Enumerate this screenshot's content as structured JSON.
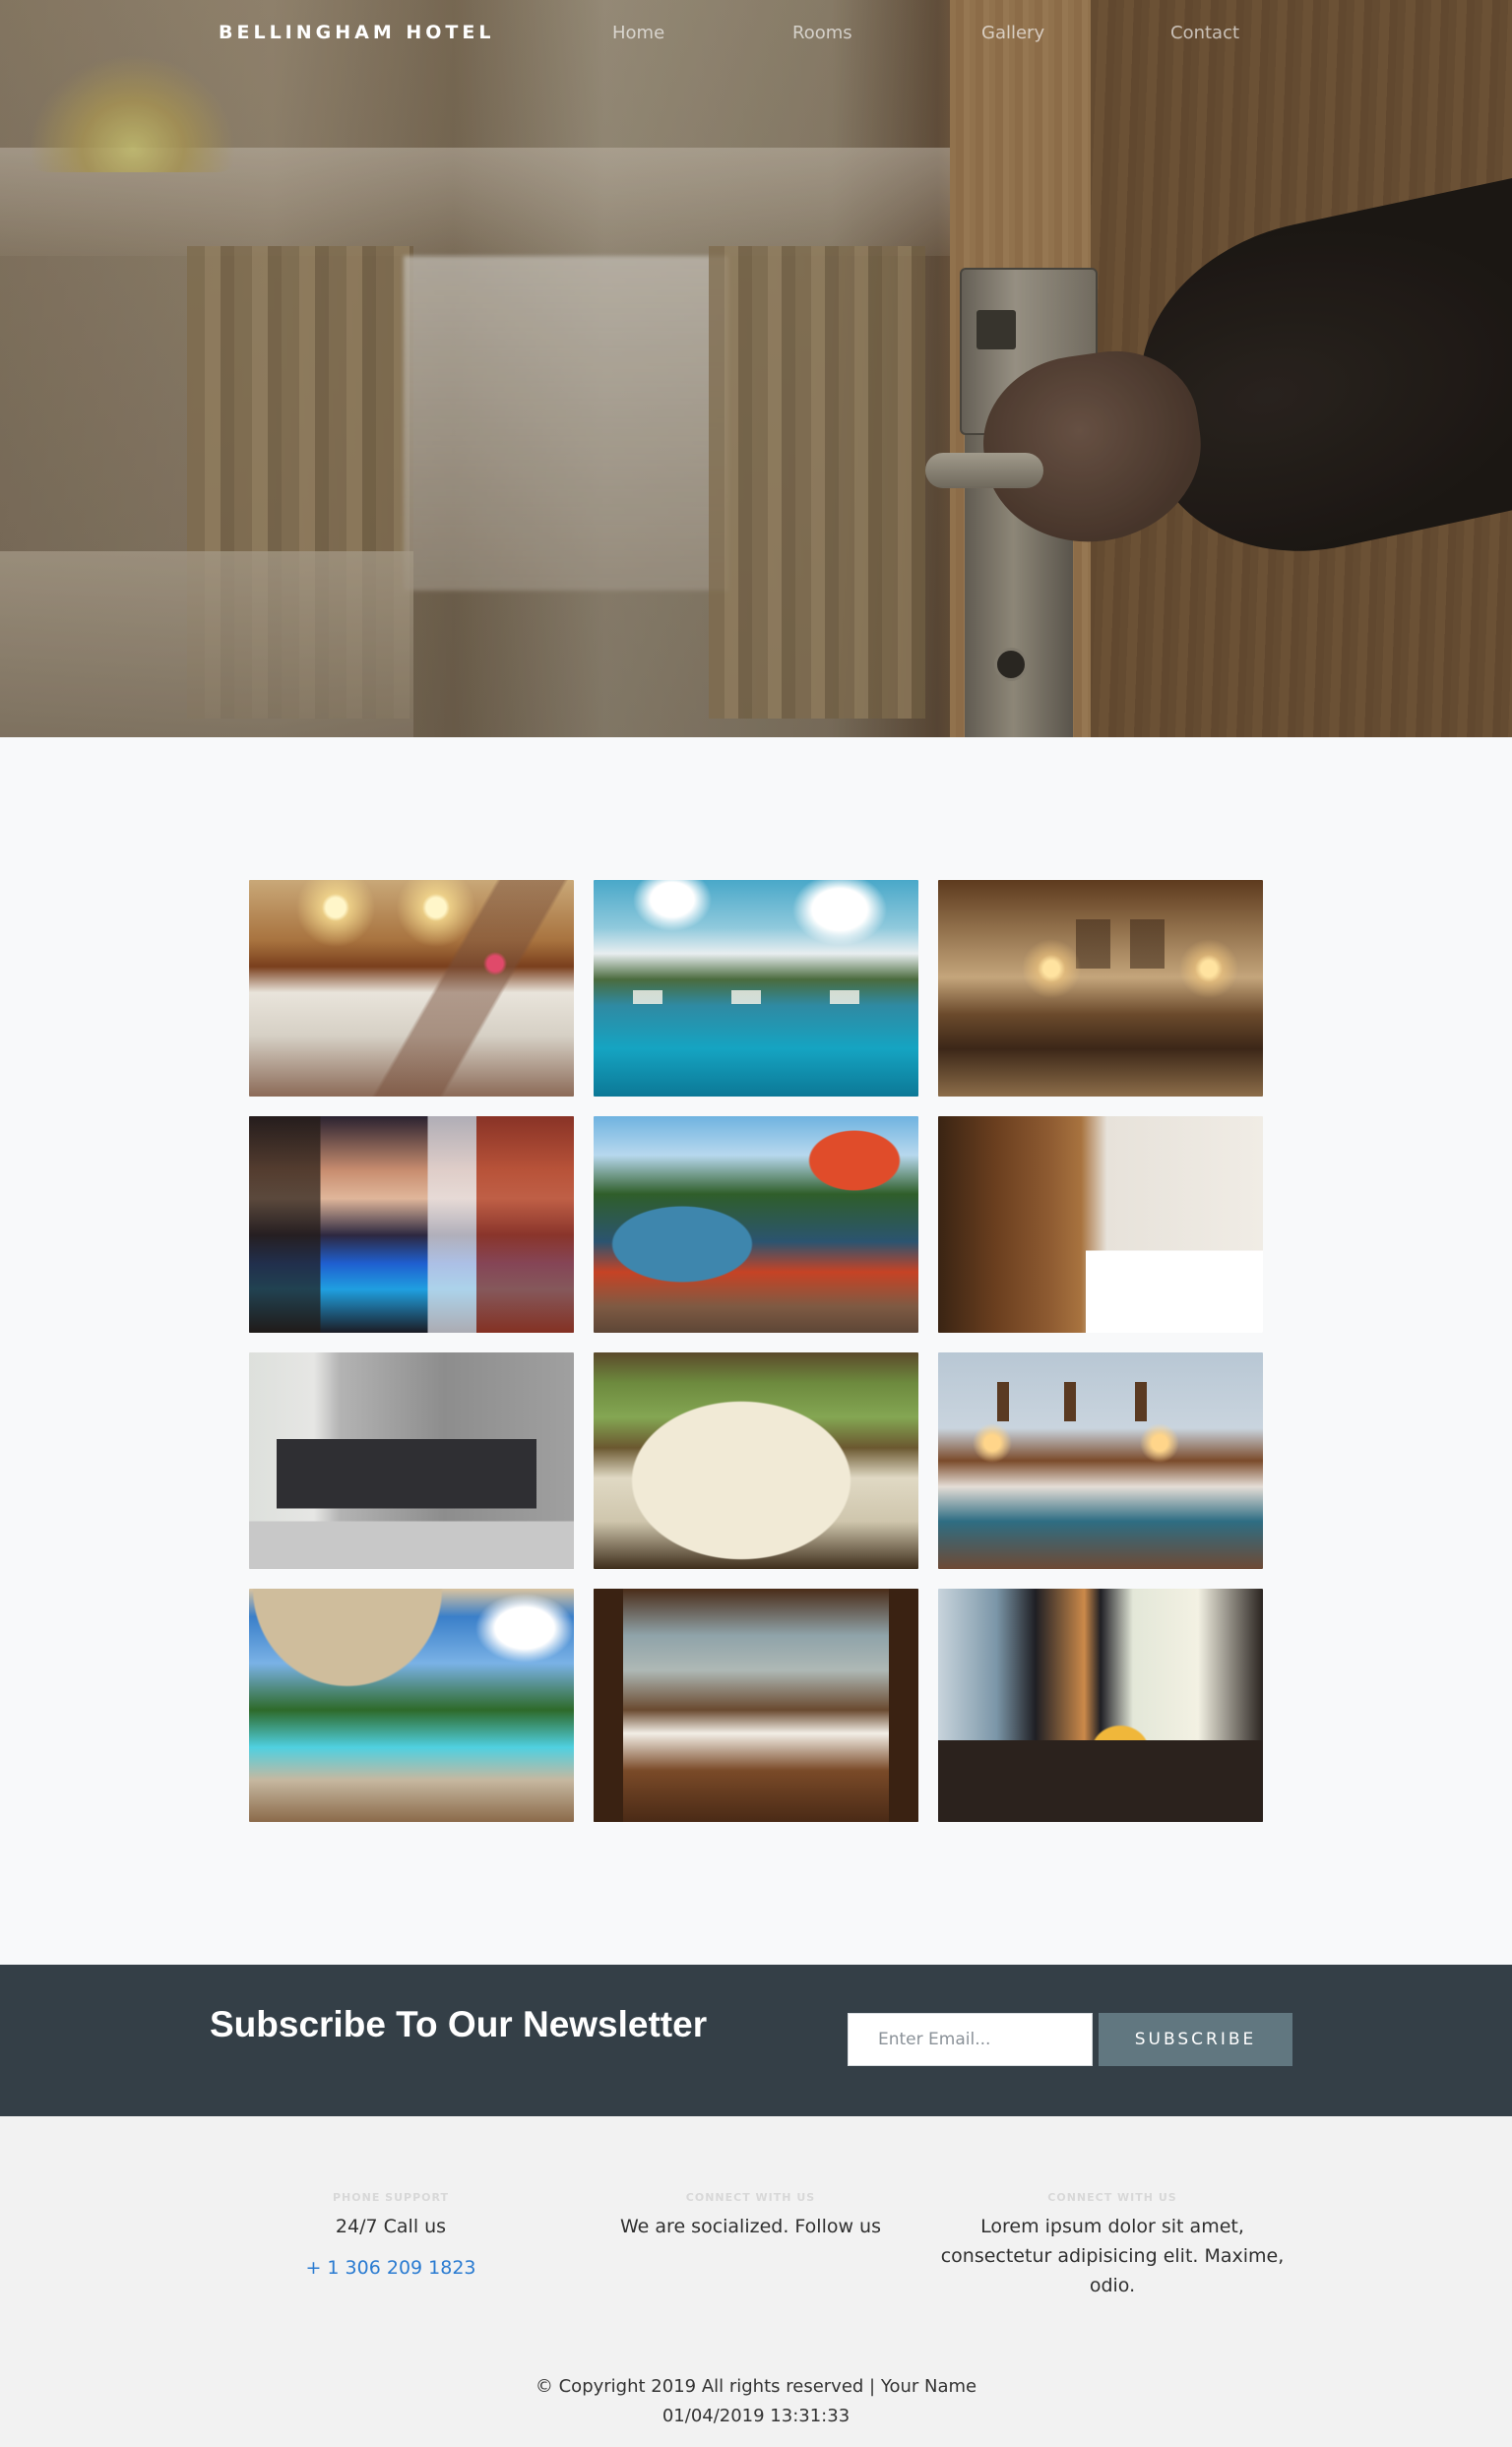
{
  "nav": {
    "brand": "BELLINGHAM HOTEL",
    "links": [
      "Home",
      "Rooms",
      "Gallery",
      "Contact"
    ]
  },
  "hero": {
    "image": "hotel-door-hand-photo"
  },
  "gallery": {
    "photos": [
      "hotel-bed-photo",
      "resort-pool-photo",
      "living-room-photo",
      "night-pool-photo",
      "palm-pool-loungers-photo",
      "wooden-bedroom-photo",
      "modern-sofa-photo",
      "sectional-sofa-photo",
      "blue-bedroom-photo",
      "beach-pool-photo",
      "dining-room-photo",
      "lounge-windows-photo"
    ]
  },
  "newsletter": {
    "title": "Subscribe To Our Newsletter",
    "email_placeholder": "Enter Email...",
    "subscribe_label": "SUBSCRIBE",
    "background": "#343f47",
    "button_color": "#617780"
  },
  "footer": {
    "phone_heading": "PHONE SUPPORT",
    "phone_text": "24/7 Call us",
    "phone_number": "+ 1 306 209 1823",
    "connect_heading_1": "CONNECT WITH US",
    "connect_text_1": "We are socialized. Follow us",
    "connect_heading_2": "CONNECT WITH US",
    "connect_text_2": "Lorem ipsum dolor sit amet, consectetur adipisicing elit. Maxime, odio.",
    "copyright": "© Copyright 2019 All rights reserved | Your Name",
    "datetime": "01/04/2019 13:31:33",
    "link_color": "#2a7bd1"
  }
}
